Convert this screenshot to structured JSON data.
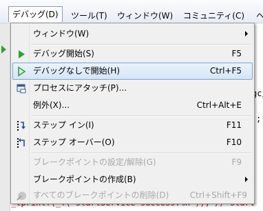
{
  "menubar": {
    "items": [
      {
        "label": "デバッグ(D)"
      },
      {
        "label": "ツール(T)"
      },
      {
        "label": "ウィンドウ(W)"
      },
      {
        "label": "コミュニティ(C)"
      },
      {
        "label": "ヘ"
      }
    ]
  },
  "background": {
    "right_snippets": [
      "gc/",
      ";"
    ],
    "bottom_line": "_tprintf(_T( startService success:%n )); // start"
  },
  "menu": {
    "items": [
      {
        "label": "ウィンドウ(W)",
        "shortcut": "",
        "submenu": true,
        "disabled": false,
        "icon": ""
      },
      {
        "label": "デバッグ開始(S)",
        "shortcut": "F5",
        "submenu": false,
        "disabled": false,
        "icon": "start-debug-icon"
      },
      {
        "label": "デバッグなしで開始(H)",
        "shortcut": "Ctrl+F5",
        "submenu": false,
        "disabled": false,
        "icon": "start-without-debug-icon",
        "highlighted": true
      },
      {
        "label": "プロセスにアタッチ(P)...",
        "shortcut": "",
        "submenu": false,
        "disabled": false,
        "icon": "attach-process-icon"
      },
      {
        "label": "例外(X)...",
        "shortcut": "Ctrl+Alt+E",
        "submenu": false,
        "disabled": false,
        "icon": ""
      },
      {
        "label": "ステップ イン(I)",
        "shortcut": "F11",
        "submenu": false,
        "disabled": false,
        "icon": "step-into-icon"
      },
      {
        "label": "ステップ オーバー(O)",
        "shortcut": "F10",
        "submenu": false,
        "disabled": false,
        "icon": "step-over-icon"
      },
      {
        "label": "ブレークポイントの設定/解除(G)",
        "shortcut": "F9",
        "submenu": false,
        "disabled": true,
        "icon": ""
      },
      {
        "label": "ブレークポイントの作成(B)",
        "shortcut": "",
        "submenu": true,
        "disabled": false,
        "icon": ""
      },
      {
        "label": "すべてのブレークポイントの削除(D)",
        "shortcut": "Ctrl+Shift+F9",
        "submenu": false,
        "disabled": true,
        "icon": "delete-breakpoints-icon"
      }
    ]
  },
  "colors": {
    "accent_green": "#2ea32e",
    "highlight_border": "#7da2ce"
  }
}
